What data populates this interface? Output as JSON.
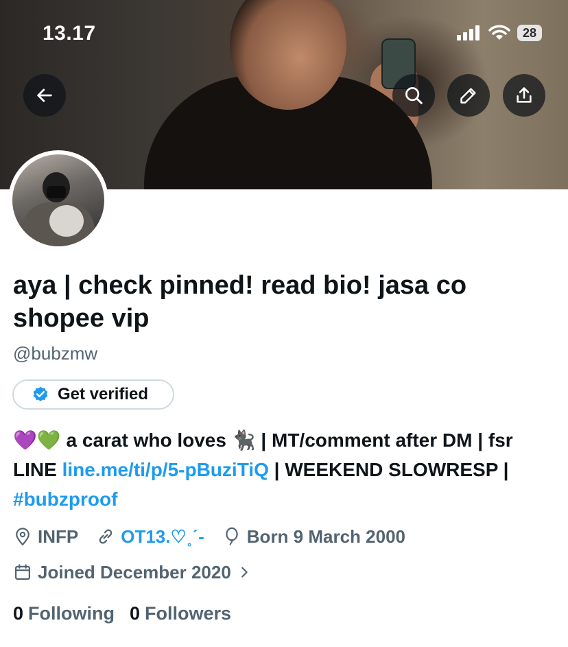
{
  "status_bar": {
    "time": "13.17",
    "battery": "28"
  },
  "profile": {
    "display_name": "aya | check pinned! read bio! jasa co shopee vip",
    "handle": "@bubzmw",
    "get_verified_label": "Get verified",
    "bio": {
      "emojis": "💜💚",
      "part1": "a carat who loves",
      "cat_emoji": "🐈‍⬛",
      "part2": "| MT/comment after DM | fsr LINE",
      "line_link": "line.me/ti/p/5-pBuziTiQ",
      "part3": "| WEEKEND SLOWRESP |",
      "hashtag": "#bubzproof"
    },
    "location": "INFP",
    "website": "OT13.♡˳ˊ-",
    "birthday": "Born 9 March 2000",
    "joined": "Joined December 2020",
    "following_count": "0",
    "following_label": "Following",
    "followers_count": "0",
    "followers_label": "Followers"
  },
  "colors": {
    "accent": "#1d9bf0",
    "text": "#0f1419",
    "muted": "#536471"
  },
  "icons": [
    "back-arrow-icon",
    "search-icon",
    "pencil-icon",
    "share-icon",
    "verified-badge-icon",
    "location-icon",
    "link-icon",
    "balloon-icon",
    "calendar-icon",
    "chevron-right-icon",
    "signal-icon",
    "wifi-icon"
  ]
}
